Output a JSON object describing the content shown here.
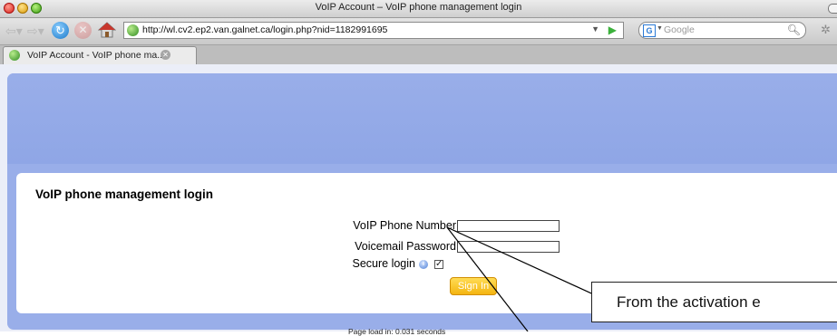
{
  "window": {
    "title": "VoIP Account – VoIP phone management login"
  },
  "toolbar": {
    "url": "http://wl.cv2.ep2.van.galnet.ca/login.php?nid=1182991695",
    "search_placeholder": "Google"
  },
  "tabs": [
    {
      "label": "VoIP Account - VoIP phone ma..."
    }
  ],
  "login": {
    "heading": "VoIP phone management login",
    "phone_label": "VoIP Phone Number",
    "phone_value": "",
    "password_label": "Voicemail Password",
    "password_value": "",
    "secure_label": "Secure login",
    "secure_checked": true,
    "submit_label": "Sign In"
  },
  "footer": {
    "load_text": "Page load in: 0.031 seconds"
  },
  "annotation": {
    "text": "From the activation e"
  },
  "colors": {
    "banner": "#99aee9",
    "page_bg": "#ebeef8",
    "button": "#f4b510"
  },
  "icons": [
    "close-window-icon",
    "minimize-window-icon",
    "zoom-window-icon",
    "back-arrow-icon",
    "forward-arrow-icon",
    "reload-icon",
    "stop-icon",
    "home-icon",
    "site-globe-icon",
    "dropdown-arrow-icon",
    "go-arrow-icon",
    "search-engine-icon",
    "magnifier-icon",
    "settings-gear-icon",
    "tab-close-icon",
    "info-icon"
  ]
}
